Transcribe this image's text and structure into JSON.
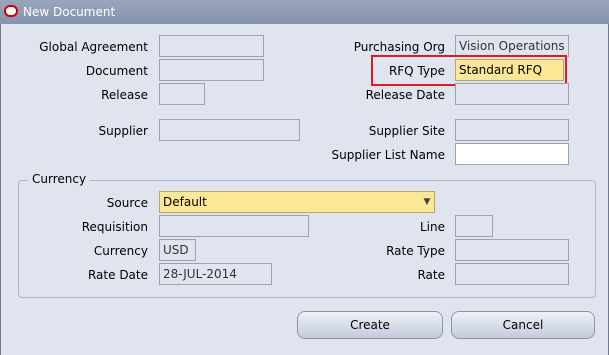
{
  "window": {
    "title": "New Document"
  },
  "header": {
    "global_agreement_label": "Global Agreement",
    "global_agreement_value": "",
    "document_label": "Document",
    "document_value": "",
    "release_label": "Release",
    "release_value": "",
    "supplier_label": "Supplier",
    "supplier_value": "",
    "purchasing_org_label": "Purchasing Org",
    "purchasing_org_value": "Vision Operations",
    "rfq_type_label": "RFQ Type",
    "rfq_type_value": "Standard RFQ",
    "release_date_label": "Release Date",
    "release_date_value": "",
    "supplier_site_label": "Supplier Site",
    "supplier_site_value": "",
    "supplier_list_name_label": "Supplier List Name",
    "supplier_list_name_value": ""
  },
  "currency": {
    "group_title": "Currency",
    "source_label": "Source",
    "source_value": "Default",
    "requisition_label": "Requisition",
    "requisition_value": "",
    "line_label": "Line",
    "line_value": "",
    "currency_label": "Currency",
    "currency_value": "USD",
    "rate_type_label": "Rate Type",
    "rate_type_value": "",
    "rate_date_label": "Rate Date",
    "rate_date_value": "28-JUL-2014",
    "rate_label": "Rate",
    "rate_value": ""
  },
  "buttons": {
    "create_label": "Create",
    "cancel_label": "Cancel"
  },
  "icons": {
    "app_logo": "oracle-logo-icon",
    "dropdown": "chevron-down-icon"
  },
  "colors": {
    "highlight": "#e01a22",
    "required_field": "#fbe897"
  }
}
